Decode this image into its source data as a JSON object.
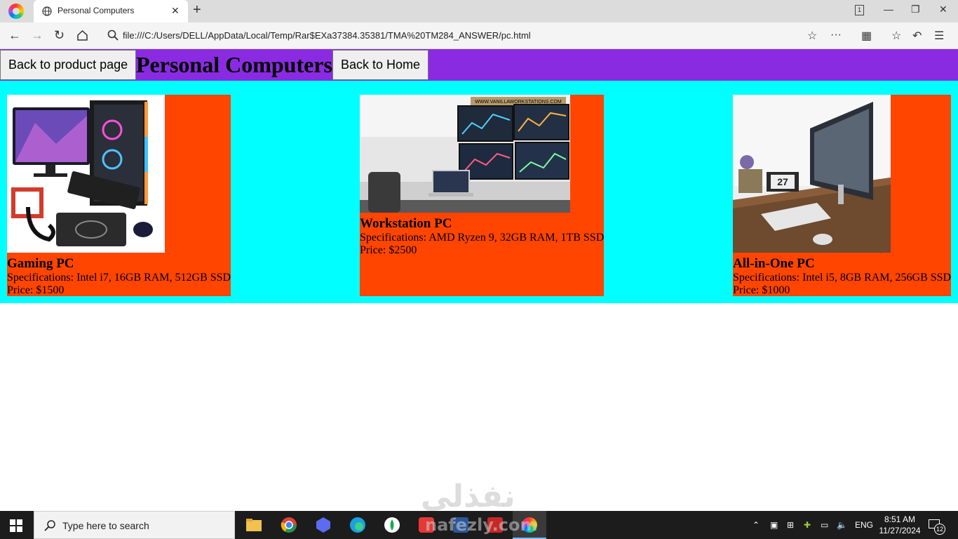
{
  "browser": {
    "tab_title": "Personal Computers",
    "address": "file:///C:/Users/DELL/AppData/Local/Temp/Rar$EXa37384.35381/TMA%20TM284_ANSWER/pc.html",
    "tab_count": "1"
  },
  "header": {
    "back_product_label": "Back to product page",
    "title": "Personal Computers",
    "back_home_label": "Back to Home"
  },
  "products": [
    {
      "name": "Gaming PC",
      "spec": "Specifications: Intel i7, 16GB RAM, 512GB SSD",
      "price": "Price: $1500"
    },
    {
      "name": "Workstation PC",
      "spec": "Specifications: AMD Ryzen 9, 32GB RAM, 1TB SSD",
      "price": "Price: $2500",
      "image_caption": "WWW.VANILLAWORKSTATIONS.COM"
    },
    {
      "name": "All-in-One PC",
      "spec": "Specifications: Intel i5, 8GB RAM, 256GB SSD",
      "price": "Price: $1000",
      "image_caption": "27"
    }
  ],
  "watermark": {
    "arabic": "نفذلي",
    "latin": "nafezly.com"
  },
  "taskbar": {
    "search_placeholder": "Type here to search",
    "language": "ENG",
    "time": "8:51 AM",
    "date": "11/27/2024",
    "notifications": "12"
  },
  "colors": {
    "header_bg": "#8a2be2",
    "products_bg": "#00ffff",
    "card_bg": "#ff4500"
  }
}
